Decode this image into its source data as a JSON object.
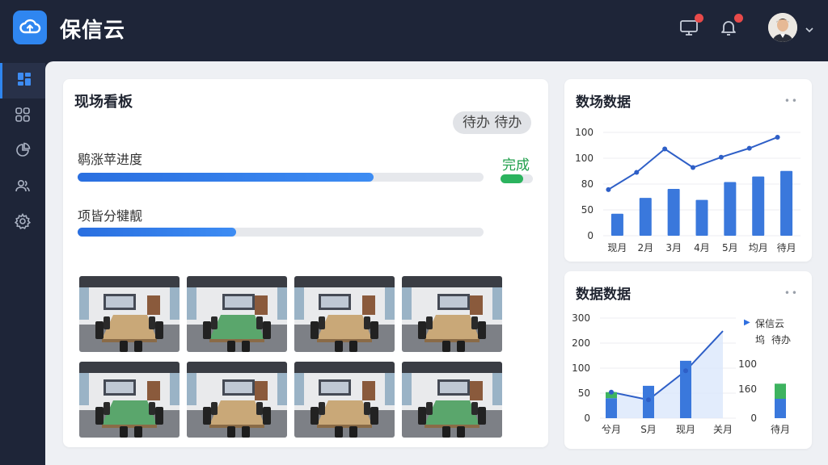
{
  "app": {
    "title": "保信云"
  },
  "icons": {
    "logo": "cloud-upload-icon",
    "monitor": "monitor-icon",
    "bell": "bell-icon",
    "dashboard": "dashboard-icon",
    "apps": "apps-grid-icon",
    "chart": "pie-chart-icon",
    "users": "users-icon",
    "settings": "gear-icon"
  },
  "colors": {
    "accent": "#2f86f0",
    "success": "#1e9e4a",
    "alert": "#e84a4a",
    "green_bar": "#2bb35e"
  },
  "board": {
    "title": "现场看板",
    "status": "待办 待办",
    "progress": [
      {
        "label": "鹖涨苹进度",
        "percent": 73
      },
      {
        "label": "项皆分犍靓",
        "percent": 39
      }
    ],
    "done_label": "完成",
    "done_percent": 70,
    "photos": [
      "会议室照片 1",
      "会议室照片 2",
      "会议室照片 3",
      "会议室照片 4",
      "会议室照片 5",
      "会议室照片 6",
      "会议室照片 7",
      "会议室照片 8"
    ]
  },
  "stats1": {
    "title": "数场数据",
    "more": "••",
    "y_ticks": [
      "100",
      "100",
      "80",
      "50",
      "0"
    ],
    "x_ticks": [
      "现月",
      "2月",
      "3月",
      "4月",
      "5月",
      "均月",
      "待月"
    ]
  },
  "stats2": {
    "title": "数据数据",
    "more": "••",
    "y_ticks": [
      "300",
      "200",
      "100",
      "50",
      "0"
    ],
    "x_ticks": [
      "兮月",
      "S月",
      "现月",
      "关月"
    ],
    "legend": [
      "保信云",
      "坞",
      "待办"
    ],
    "side_y_ticks": [
      "100",
      "160",
      "0"
    ],
    "side_x_tick": "待月"
  },
  "chart_data": [
    {
      "type": "bar",
      "categories": [
        "现月",
        "2月",
        "3月",
        "4月",
        "5月",
        "均月",
        "待月"
      ],
      "series": [
        {
          "values": [
            32,
            55,
            68,
            52,
            78,
            86,
            94
          ]
        },
        {
          "values": [
            67,
            92,
            126,
            99,
            114,
            127,
            143
          ]
        }
      ],
      "ylim": [
        0,
        150
      ]
    },
    {
      "type": "bar",
      "categories": [
        "兮月",
        "S月",
        "现月",
        "关月"
      ],
      "series": [
        {
          "values": [
            60,
            97,
            172,
            0
          ]
        },
        {
          "values": [
            18,
            0,
            0,
            0
          ]
        },
        {
          "values": [
            78,
            55,
            142,
            261
          ]
        }
      ],
      "ylim": [
        0,
        300
      ]
    },
    {
      "type": "bar",
      "categories": [
        "待月"
      ],
      "series": [
        {
          "values": [
            100
          ]
        },
        {
          "values": [
            78
          ]
        }
      ],
      "ylim": [
        0,
        180
      ]
    }
  ]
}
